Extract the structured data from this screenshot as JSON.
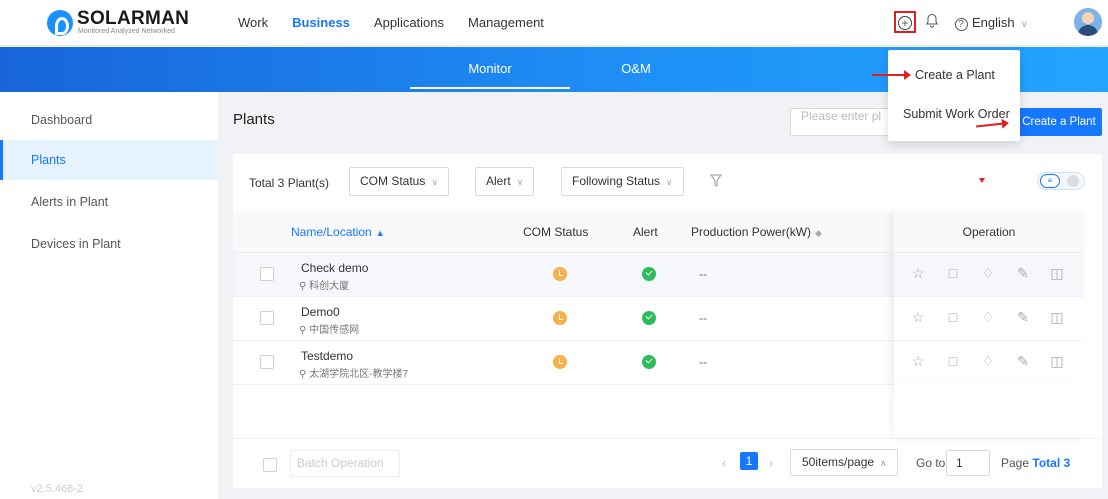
{
  "header": {
    "logo_title": "SOLARMAN",
    "logo_subtitle": "Monitored Analyzed Networked",
    "nav": [
      {
        "label": "Work"
      },
      {
        "label": "Business"
      },
      {
        "label": "Applications"
      },
      {
        "label": "Management"
      }
    ],
    "active_nav": "Business",
    "language": "English"
  },
  "subnav": {
    "tabs": [
      {
        "label": "Monitor"
      },
      {
        "label": "O&M"
      }
    ],
    "active": "Monitor"
  },
  "sidebar": {
    "items": [
      {
        "label": "Dashboard"
      },
      {
        "label": "Plants"
      },
      {
        "label": "Alerts in Plant"
      },
      {
        "label": "Devices in Plant"
      }
    ],
    "active": "Plants",
    "version": "v2.5.468-2"
  },
  "main": {
    "title": "Plants",
    "search_placeholder": "Please enter pl",
    "create_button": "Create a Plant"
  },
  "filters": {
    "total": "Total 3 Plant(s)",
    "com_status": "COM Status",
    "alert": "Alert",
    "following": "Following Status"
  },
  "table": {
    "columns": {
      "name": "Name/Location",
      "com": "COM Status",
      "alert": "Alert",
      "power": "Production Power(kW)",
      "operation": "Operation"
    },
    "rows": [
      {
        "name": "Check demo",
        "location": "科创大厦",
        "com_status": "offline",
        "alert": "normal",
        "power": "--"
      },
      {
        "name": "Demo0",
        "location": "中国传感网",
        "com_status": "offline",
        "alert": "normal",
        "power": "--"
      },
      {
        "name": "Testdemo",
        "location": "太湖学院北区-教学楼7",
        "com_status": "offline",
        "alert": "normal",
        "power": "--"
      }
    ]
  },
  "footer": {
    "batch": "Batch Operation",
    "current_page": "1",
    "page_size": "50items/page",
    "goto_label": "Go to",
    "goto_value": "1",
    "page_label": "Page",
    "total": "Total 3"
  },
  "add_menu": {
    "items": [
      {
        "label": "Create a Plant"
      },
      {
        "label": "Submit Work Order"
      }
    ]
  },
  "colors": {
    "accent": "#1677ff",
    "highlight_red": "#e02020",
    "status_offline": "#f7b04c",
    "status_ok": "#2dbb5d"
  },
  "icons": {
    "row_operations": [
      "star-icon",
      "assign-icon",
      "tag-icon",
      "edit-icon",
      "delete-icon"
    ]
  }
}
